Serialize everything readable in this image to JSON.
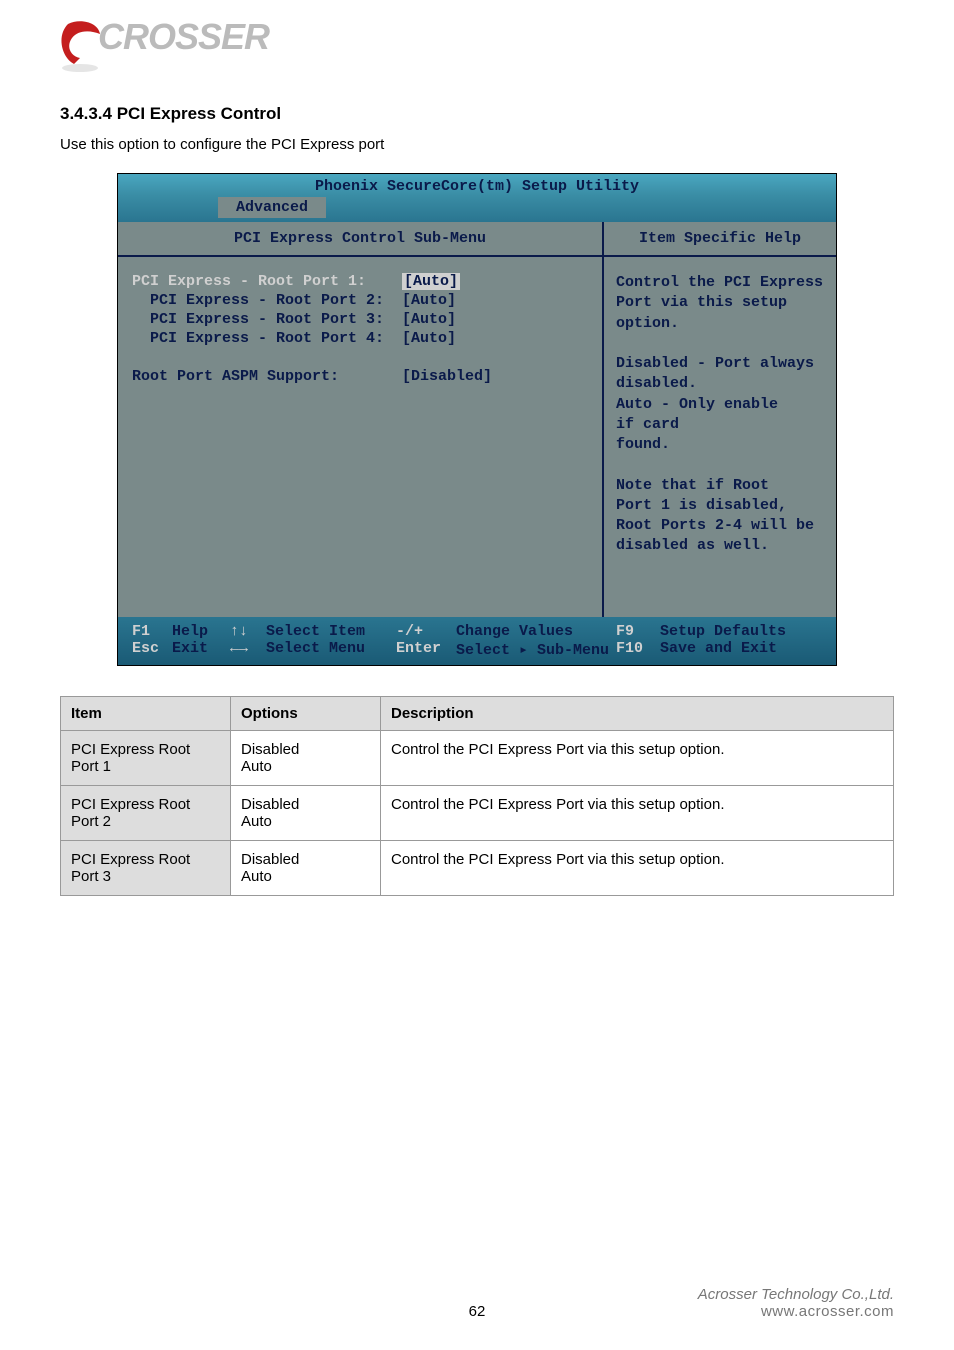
{
  "logo": {
    "text": "CROSSER"
  },
  "heading": "3.4.3.4 PCI Express Control",
  "desc": "Use this option to configure the PCI Express port",
  "bios": {
    "title": "Phoenix SecureCore(tm) Setup Utility",
    "tab": "Advanced",
    "left_header": "PCI Express Control Sub-Menu",
    "right_header": "Item Specific Help",
    "rows": [
      {
        "label": "PCI Express - Root Port 1:",
        "value": "[Auto]",
        "selected": true,
        "sub": false
      },
      {
        "label": "PCI Express - Root Port 2:",
        "value": "[Auto]",
        "selected": false,
        "sub": true
      },
      {
        "label": "PCI Express - Root Port 3:",
        "value": "[Auto]",
        "selected": false,
        "sub": true
      },
      {
        "label": "PCI Express - Root Port 4:",
        "value": "[Auto]",
        "selected": false,
        "sub": true
      },
      {
        "label": "",
        "value": "",
        "selected": false,
        "sub": false
      },
      {
        "label": "Root Port ASPM Support:",
        "value": "[Disabled]",
        "selected": false,
        "sub": false
      }
    ],
    "help": "Control the PCI Express Port via this setup option.\n\nDisabled - Port always\n           disabled.\nAuto     - Only enable\n           if card\n           found.\n\nNote that if Root\nPort 1 is disabled,\nRoot Ports 2-4 will be\ndisabled as well.",
    "footer": {
      "l1": {
        "k1": "F1",
        "l1": "Help",
        "a1": "↑↓",
        "ac1": "Select Item",
        "op": "-/+",
        "v": "Change Values",
        "k2": "F9",
        "e": "Setup Defaults"
      },
      "l2": {
        "k1": "Esc",
        "l1": "Exit",
        "a1": "←→",
        "ac1": "Select Menu",
        "op": "Enter",
        "v": "Select ▸ Sub-Menu",
        "k2": "F10",
        "e": "Save and Exit"
      }
    }
  },
  "table": {
    "headers": [
      "Item",
      "Options",
      "Description"
    ],
    "rows": [
      {
        "c1": "PCI Express Root Port 1",
        "c2": "Disabled\nAuto",
        "c3": "Control the PCI Express Port via this setup option."
      },
      {
        "c1": "PCI Express Root Port 2",
        "c2": "Disabled\nAuto",
        "c3": "Control the PCI Express Port via this setup option."
      },
      {
        "c1": "PCI Express Root Port 3",
        "c2": "Disabled\nAuto",
        "c3": "Control the PCI Express Port via this setup option."
      }
    ]
  },
  "footer": {
    "line1": "Acrosser Technology Co.,Ltd.",
    "line2": "www.acrosser.com"
  },
  "page": "62"
}
